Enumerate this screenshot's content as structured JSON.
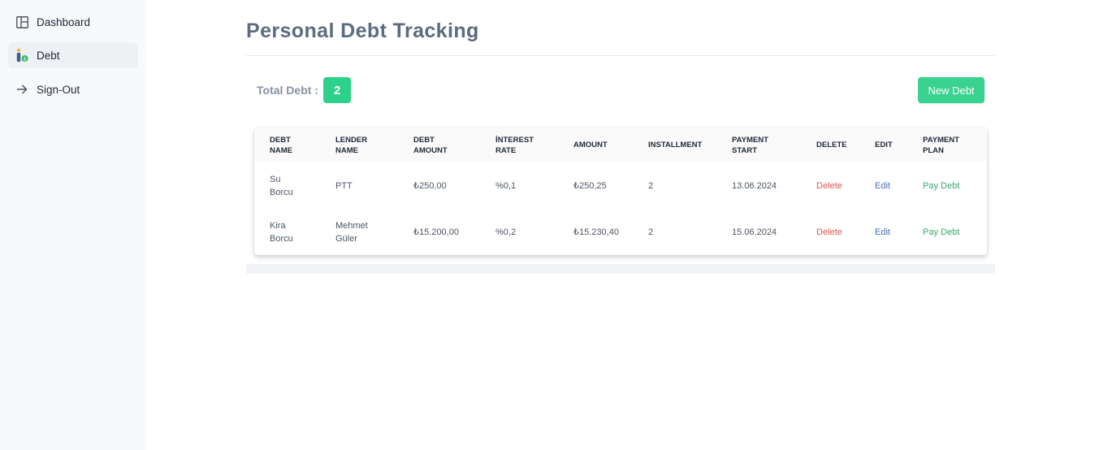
{
  "sidebar": {
    "items": [
      {
        "label": "Dashboard",
        "icon": "layout-icon"
      },
      {
        "label": "Debt",
        "icon": "person-money-icon",
        "active": true
      },
      {
        "label": "Sign-Out",
        "icon": "arrow-right-icon"
      }
    ]
  },
  "page": {
    "title": "Personal Debt Tracking",
    "total_label": "Total Debt :",
    "total_count": "2",
    "new_debt_label": "New Debt"
  },
  "table": {
    "headers": [
      [
        "DEBT",
        "NAME"
      ],
      [
        "LENDER",
        "NAME"
      ],
      [
        "DEBT",
        "AMOUNT"
      ],
      [
        "İNTEREST",
        "RATE"
      ],
      [
        "AMOUNT"
      ],
      [
        "INSTALLMENT"
      ],
      [
        "PAYMENT",
        "START"
      ],
      [
        "DELETE"
      ],
      [
        "EDIT"
      ],
      [
        "PAYMENT",
        "PLAN"
      ]
    ],
    "rows": [
      {
        "debt_name": [
          "Su",
          "Borcu"
        ],
        "lender_name": [
          "PTT"
        ],
        "debt_amount": "₺250,00",
        "interest_rate": "%0,1",
        "amount": "₺250,25",
        "installment": "2",
        "payment_start": "13.06.2024",
        "delete": "Delete",
        "edit": "Edit",
        "pay": "Pay Debt"
      },
      {
        "debt_name": [
          "Kira",
          "Borcu"
        ],
        "lender_name": [
          "Mehmet",
          "Güler"
        ],
        "debt_amount": "₺15.200,00",
        "interest_rate": "%0,2",
        "amount": "₺15.230,40",
        "installment": "2",
        "payment_start": "15.06.2024",
        "delete": "Delete",
        "edit": "Edit",
        "pay": "Pay Debt"
      }
    ]
  },
  "colors": {
    "accent": "#3ad291",
    "delete": "#e05353",
    "edit": "#4a6fb5",
    "pay": "#37a76a"
  }
}
